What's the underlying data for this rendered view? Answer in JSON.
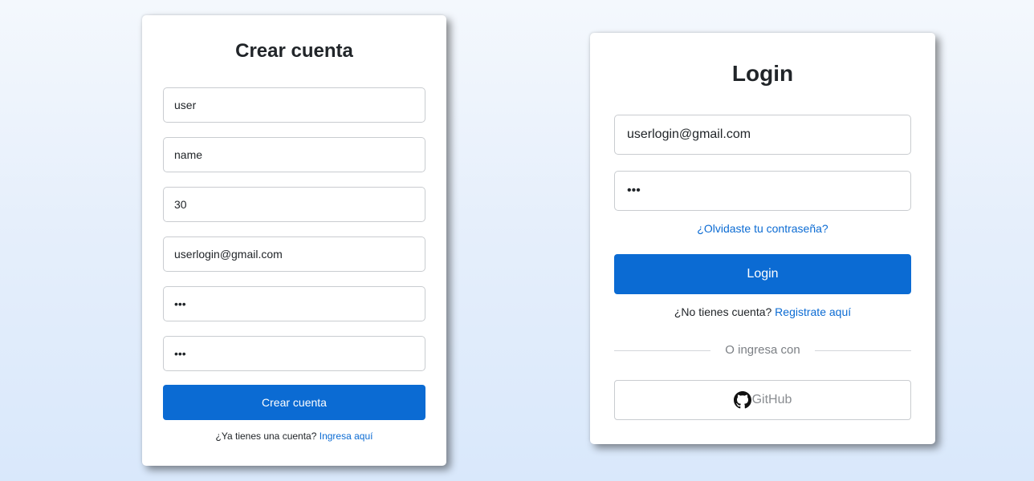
{
  "register": {
    "title": "Crear cuenta",
    "fields": {
      "username": "user",
      "name": "name",
      "age": "30",
      "email": "userlogin@gmail.com",
      "password": "•••",
      "confirm_password": "•••"
    },
    "submit_label": "Crear cuenta",
    "footer_text": "¿Ya tienes una cuenta?",
    "footer_link": "Ingresa aquí"
  },
  "login": {
    "title": "Login",
    "fields": {
      "email": "userlogin@gmail.com",
      "password": "•••"
    },
    "forgot_link": "¿Olvidaste tu contraseña?",
    "submit_label": "Login",
    "signup_text": "¿No tienes cuenta?",
    "signup_link": "Registrate aquí",
    "divider_text": "O ingresa con",
    "github_label": "GitHub",
    "github_icon": "github-icon"
  },
  "colors": {
    "primary": "#0b6bd3",
    "text": "#212529",
    "muted": "#7b7f84"
  }
}
